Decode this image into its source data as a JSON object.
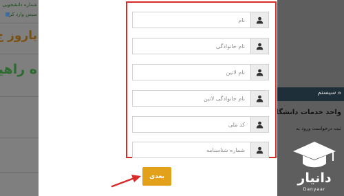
{
  "background": {
    "left_texts": [
      "شماره دانشجویی",
      "سیس وارد کر",
      "یاروز ج",
      "ه راهیا"
    ],
    "right_texts": [
      "ه سیستم",
      "واحد خدمات دانشگاه",
      "ثبت درخواست ورود به"
    ]
  },
  "form": {
    "fields": [
      {
        "placeholder": "نام"
      },
      {
        "placeholder": "نام خانوادگی"
      },
      {
        "placeholder": "نام لاتین"
      },
      {
        "placeholder": "نام خانوادگی لاتین"
      },
      {
        "placeholder": "کد ملی"
      },
      {
        "placeholder": "شماره شناسنامه"
      }
    ],
    "next_label": "بعدی"
  },
  "logo": {
    "name": "دانیار",
    "subtitle": "Danyaar"
  },
  "colors": {
    "highlight": "#d92a2a",
    "button": "#e3a11b"
  }
}
